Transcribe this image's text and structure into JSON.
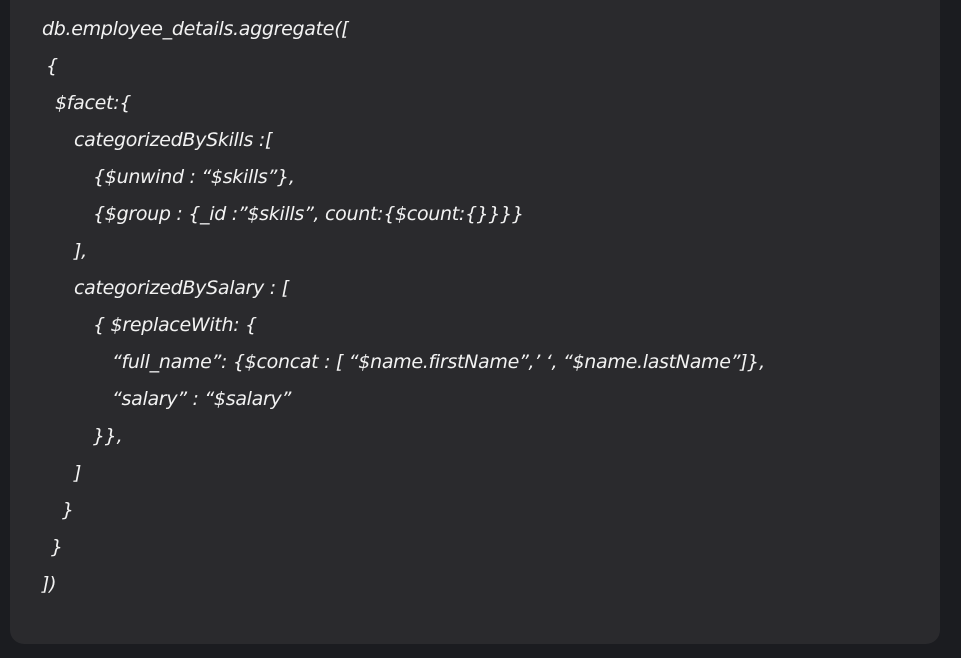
{
  "code": {
    "lines": [
      "db.employee_details.aggregate([",
      "{",
      "$facet:{",
      "categorizedBySkills :[",
      "{$unwind : “$skills”},",
      "{$group : {_id :”$skills”, count:{$count:{}}}}",
      "],",
      "categorizedBySalary : [",
      "{ $replaceWith: {",
      "“full_name”: {$concat : [ “$name.firstName”,’ ‘, “$name.lastName”]},",
      "“salary” : “$salary”",
      "}},",
      "]",
      "}",
      "}",
      "])"
    ]
  }
}
